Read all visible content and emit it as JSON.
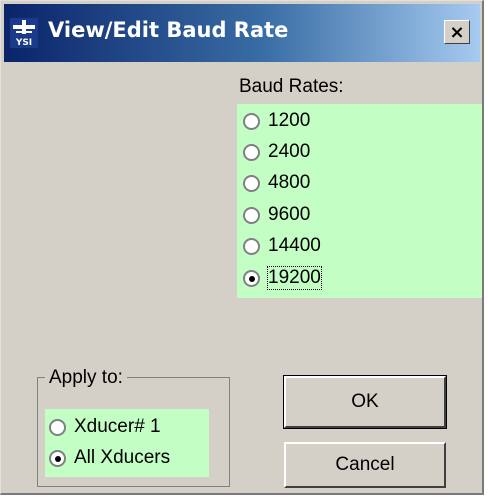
{
  "window": {
    "title": "View/Edit Baud Rate",
    "icon_name": "ysi-app-icon",
    "icon_text": "YSI",
    "close_label": "×",
    "titlebar_colors": [
      "#0a246a",
      "#a6caf0"
    ]
  },
  "baud": {
    "label": "Baud Rates:",
    "panel_color": "#c3fec4",
    "options": [
      {
        "label": "1200",
        "checked": false
      },
      {
        "label": "2400",
        "checked": false
      },
      {
        "label": "4800",
        "checked": false
      },
      {
        "label": "9600",
        "checked": false
      },
      {
        "label": "14400",
        "checked": false
      },
      {
        "label": "19200",
        "checked": true
      }
    ]
  },
  "apply": {
    "legend": "Apply to:",
    "options": [
      {
        "label": "Xducer# 1",
        "checked": false
      },
      {
        "label": "All Xducers",
        "checked": true
      }
    ]
  },
  "buttons": {
    "ok": "OK",
    "cancel": "Cancel"
  }
}
